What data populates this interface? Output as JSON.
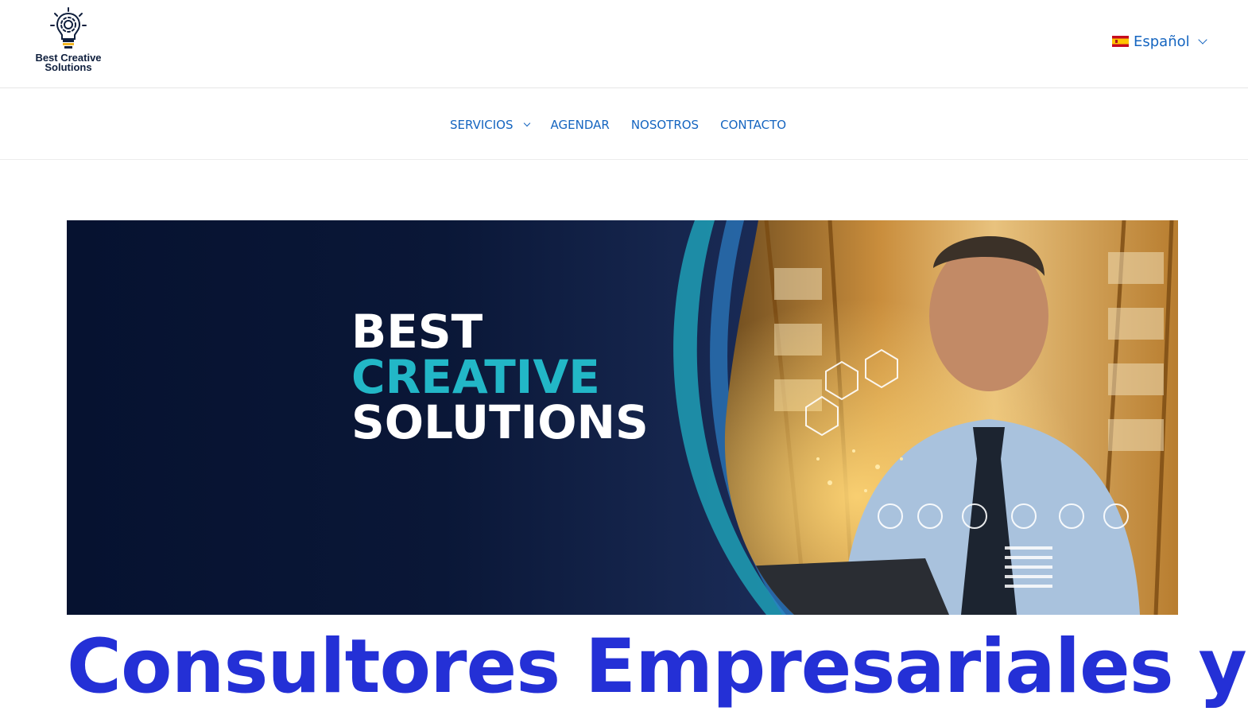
{
  "brand": {
    "name_line1": "Best Creative",
    "name_line2": "Solutions"
  },
  "language": {
    "selected": "Español",
    "flag_icon": "spain-flag-icon"
  },
  "nav": {
    "items": [
      {
        "label": "SERVICIOS",
        "has_dropdown": true
      },
      {
        "label": "AGENDAR"
      },
      {
        "label": "NOSOTROS"
      },
      {
        "label": "CONTACTO"
      }
    ]
  },
  "hero": {
    "line1": "BEST",
    "line2": "CREATIVE",
    "line3": "SOLUTIONS"
  },
  "main": {
    "heading": "Consultores Empresariales y"
  },
  "colors": {
    "link": "#1565c0",
    "heading": "#2430d6",
    "hero_bg": "#0a1737",
    "hero_accent": "#22b7c7"
  }
}
